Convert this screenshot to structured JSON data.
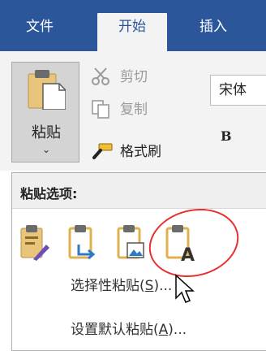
{
  "tabs": [
    {
      "label": "文件",
      "active": false
    },
    {
      "label": "开始",
      "active": true
    },
    {
      "label": "插入",
      "active": false
    }
  ],
  "clipboard": {
    "paste_label": "粘贴",
    "paste_caret": "⌄",
    "cut_label": "剪切",
    "copy_label": "复制",
    "format_painter_label": "格式刷"
  },
  "font": {
    "name": "宋体",
    "bold_label": "B"
  },
  "paste_menu": {
    "header": "粘贴选项:",
    "options": [
      {
        "icon": "keep-source-formatting-icon"
      },
      {
        "icon": "merge-formatting-icon"
      },
      {
        "icon": "picture-icon"
      },
      {
        "icon": "keep-text-only-icon"
      }
    ],
    "items": [
      {
        "text": "选择性粘贴(",
        "key": "S",
        "suffix": ")..."
      },
      {
        "text": "设置默认粘贴(",
        "key": "A",
        "suffix": ")..."
      }
    ]
  },
  "colors": {
    "ribbon_blue": "#2b579a",
    "highlight_red": "#e6312f",
    "clipboard_tan": "#e8c57a"
  }
}
